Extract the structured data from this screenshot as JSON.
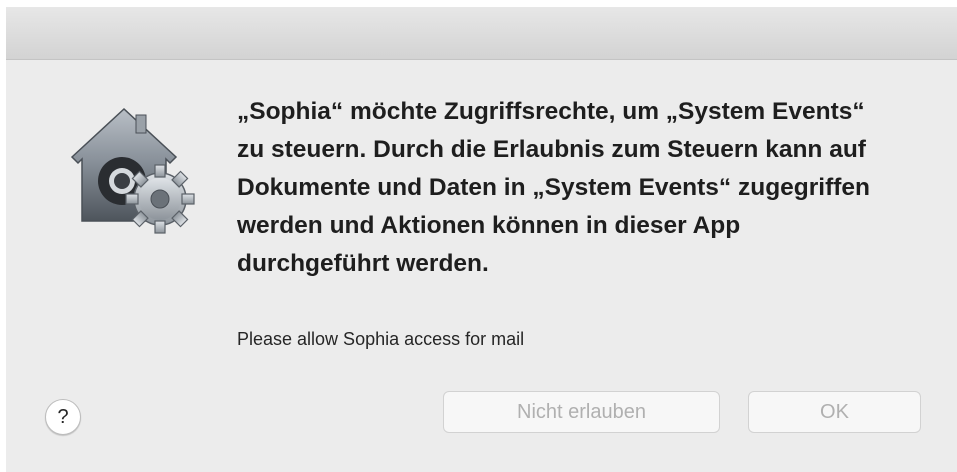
{
  "dialog": {
    "message": "„Sophia“ möchte Zugriffsrechte, um „System Events“ zu steuern. Durch die Erlaubnis zum Steuern kann auf Dokumente und Daten in „System Events“ zugegriffen werden und Aktionen können in dieser App durchgeführt werden.",
    "info": "Please allow Sophia access for mail",
    "help_label": "?",
    "deny_label": "Nicht erlauben",
    "ok_label": "OK",
    "icon": "privacy-gatekeeper-icon"
  },
  "colors": {
    "dialog_background": "#ececec",
    "disabled_text": "#b0b0b0"
  }
}
